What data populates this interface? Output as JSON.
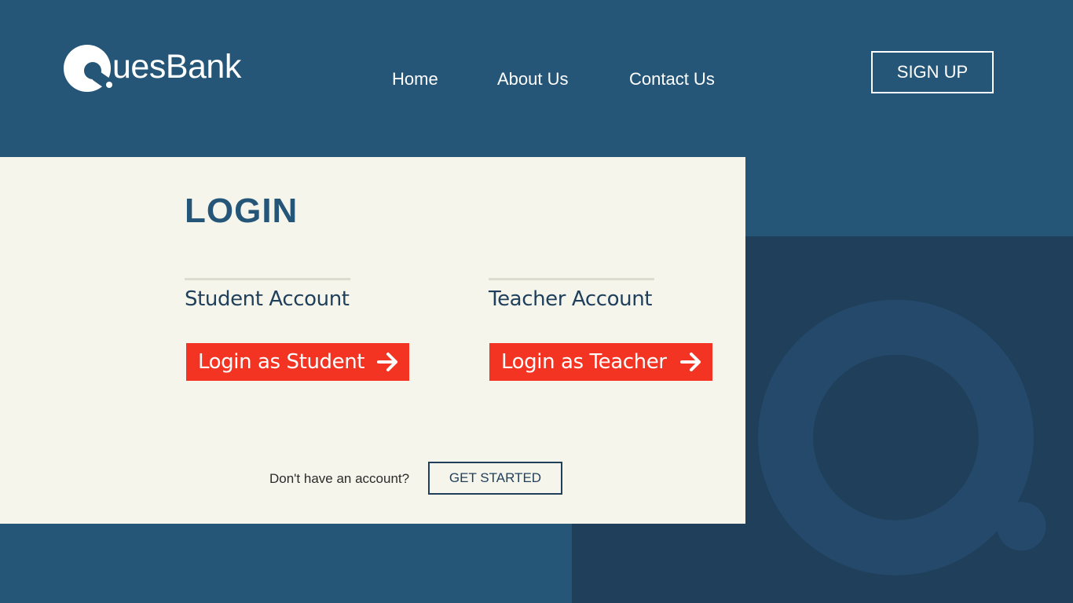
{
  "brand": {
    "name": "uesBank",
    "logo_icon": "q-logo-icon"
  },
  "nav": {
    "home": "Home",
    "about": "About Us",
    "contact": "Contact Us"
  },
  "header": {
    "signup_label": "SIGN UP"
  },
  "login": {
    "title": "LOGIN",
    "student": {
      "heading": "Student Account",
      "button_label": "Login as Student",
      "button_icon": "arrow-right-icon"
    },
    "teacher": {
      "heading": "Teacher Account",
      "button_label": "Login as Teacher",
      "button_icon": "arrow-right-icon"
    },
    "no_account_text": "Don't have an account?",
    "get_started_label": "GET STARTED"
  },
  "colors": {
    "background": "#255677",
    "background_dark": "#1f3f5b",
    "panel": "#f5f5ec",
    "accent": "#f43422",
    "text_dark": "#1f3f5b"
  }
}
